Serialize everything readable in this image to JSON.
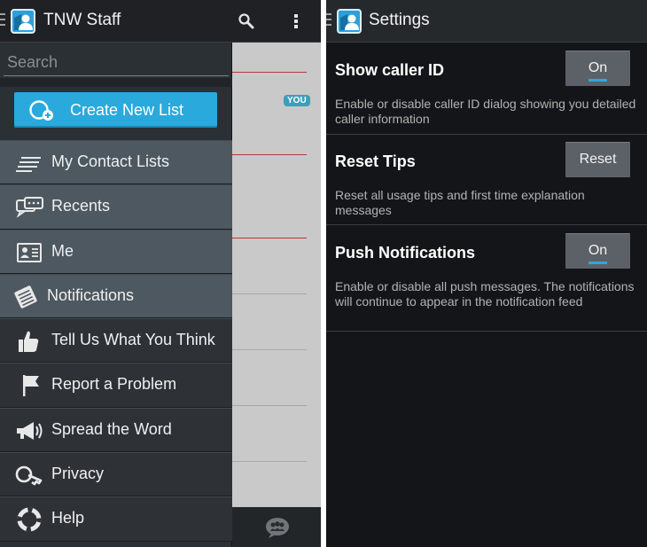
{
  "left_panel": {
    "title": "TNW Staff",
    "search_placeholder": "Search",
    "create_button": "Create New List",
    "you_badge": "YOU",
    "menu": [
      {
        "label": "My Contact Lists",
        "icon": "list-lines-icon"
      },
      {
        "label": "Recents",
        "icon": "chat-bubbles-icon"
      },
      {
        "label": "Me",
        "icon": "id-card-icon"
      },
      {
        "label": "Notifications",
        "icon": "notepad-icon"
      },
      {
        "label": "Tell Us What You Think",
        "icon": "thumbs-up-icon"
      },
      {
        "label": "Report a Problem",
        "icon": "flag-icon"
      },
      {
        "label": "Spread the Word",
        "icon": "megaphone-icon"
      },
      {
        "label": "Privacy",
        "icon": "key-icon"
      },
      {
        "label": "Help",
        "icon": "lifebuoy-icon"
      }
    ]
  },
  "right_panel": {
    "title": "Settings",
    "settings": [
      {
        "title": "Show caller ID",
        "button": "On",
        "toggle_on": true,
        "description": "Enable or disable caller ID dialog showing you detailed caller information"
      },
      {
        "title": "Reset Tips",
        "button": "Reset",
        "toggle_on": false,
        "description": "Reset all usage tips and first time explanation messages"
      },
      {
        "title": "Push Notifications",
        "button": "On",
        "toggle_on": true,
        "description": "Enable or disable all push messages. The notifications will continue to appear in the notification feed"
      }
    ]
  },
  "colors": {
    "accent": "#2aa9dc",
    "drawer": "#2b3035",
    "menu_highlight": "#4d5860",
    "action_bar": "#1f2124",
    "settings_bg": "#141518",
    "separator_red": "#b33a3a"
  }
}
